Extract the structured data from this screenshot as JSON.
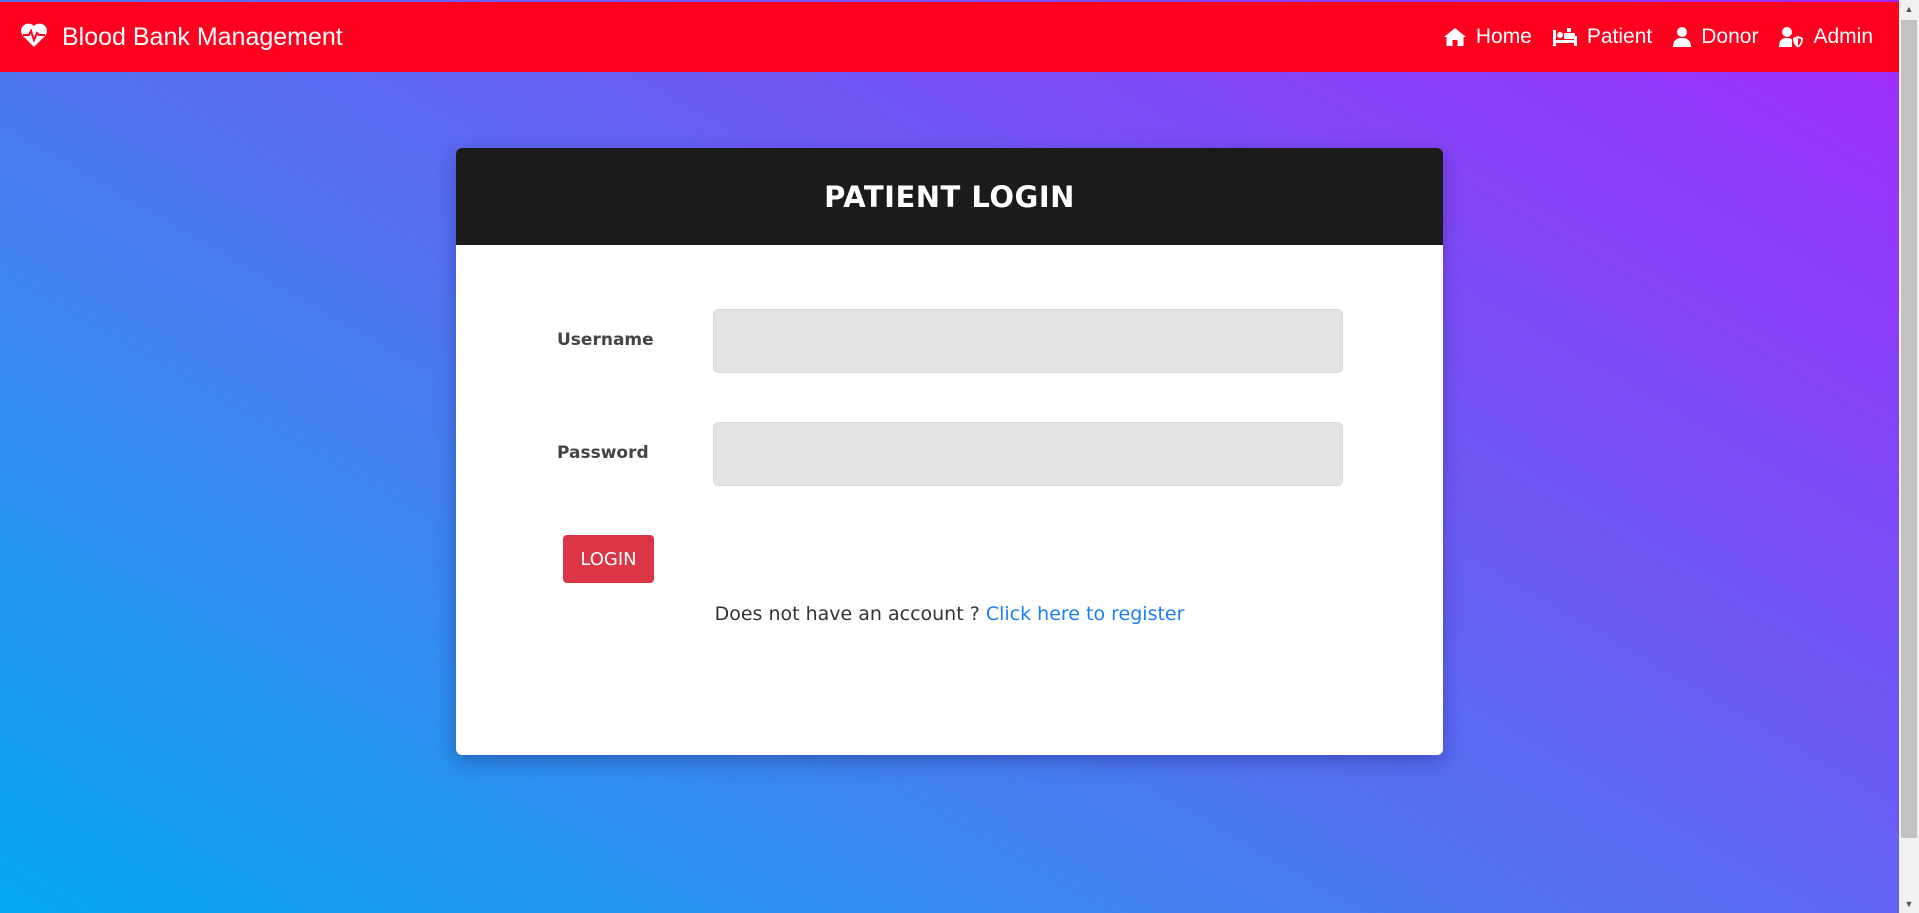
{
  "navbar": {
    "brand_icon": "heartbeat-icon",
    "brand_text": "Blood Bank Management",
    "items": [
      {
        "label": "Home",
        "icon": "home-icon"
      },
      {
        "label": "Patient",
        "icon": "hospital-bed-icon"
      },
      {
        "label": "Donor",
        "icon": "user-icon"
      },
      {
        "label": "Admin",
        "icon": "user-shield-icon"
      }
    ]
  },
  "login": {
    "title": "PATIENT LOGIN",
    "username_label": "Username",
    "username_value": "",
    "password_label": "Password",
    "password_value": "",
    "button_label": "LOGIN",
    "register_prompt": "Does not have an account ?",
    "register_link": "Click here to register"
  },
  "colors": {
    "navbar": "#ff001e",
    "card_header": "#1b1b1b",
    "login_button": "#dc3545",
    "link": "#1e7ef0"
  }
}
